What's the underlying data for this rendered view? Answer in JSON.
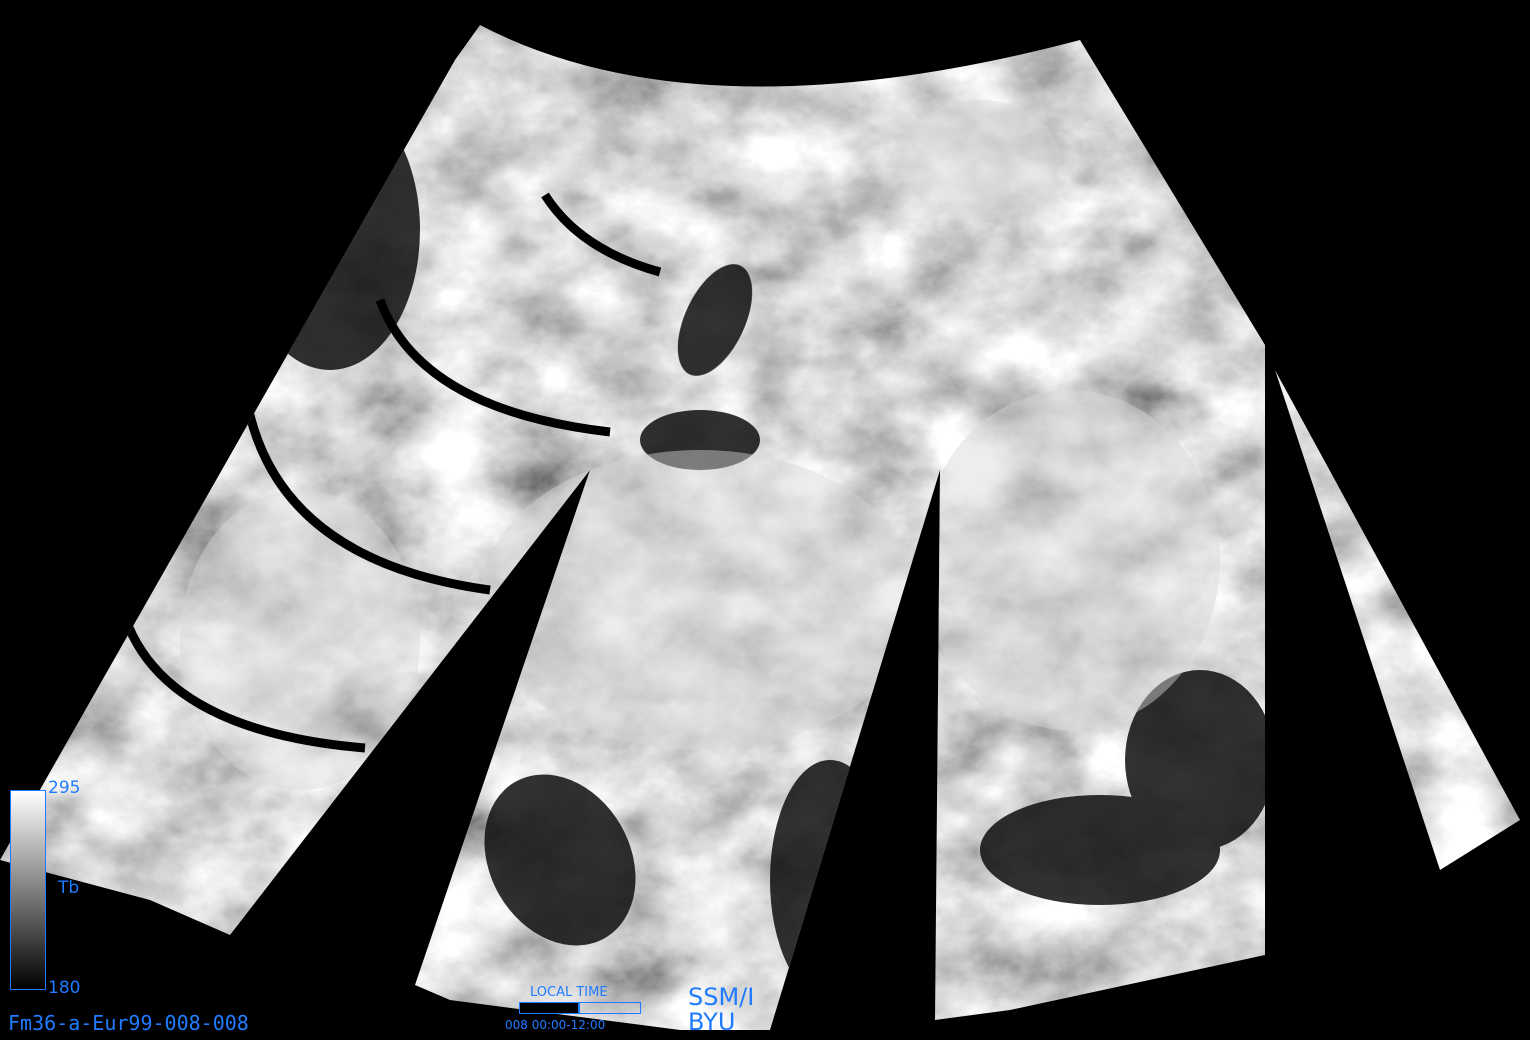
{
  "image": {
    "file_id": "Fm36-a-Eur99-008-008",
    "background_color": "#000000",
    "annotation_color": "#1f7bff"
  },
  "colorbar": {
    "variable": "Tb",
    "max": "295",
    "min": "180"
  },
  "local_time": {
    "label": "LOCAL TIME",
    "range": "008 00:00-12:00",
    "fill_fraction": 0.5
  },
  "credits": {
    "sensor": "SSM/I",
    "organization": "BYU"
  }
}
